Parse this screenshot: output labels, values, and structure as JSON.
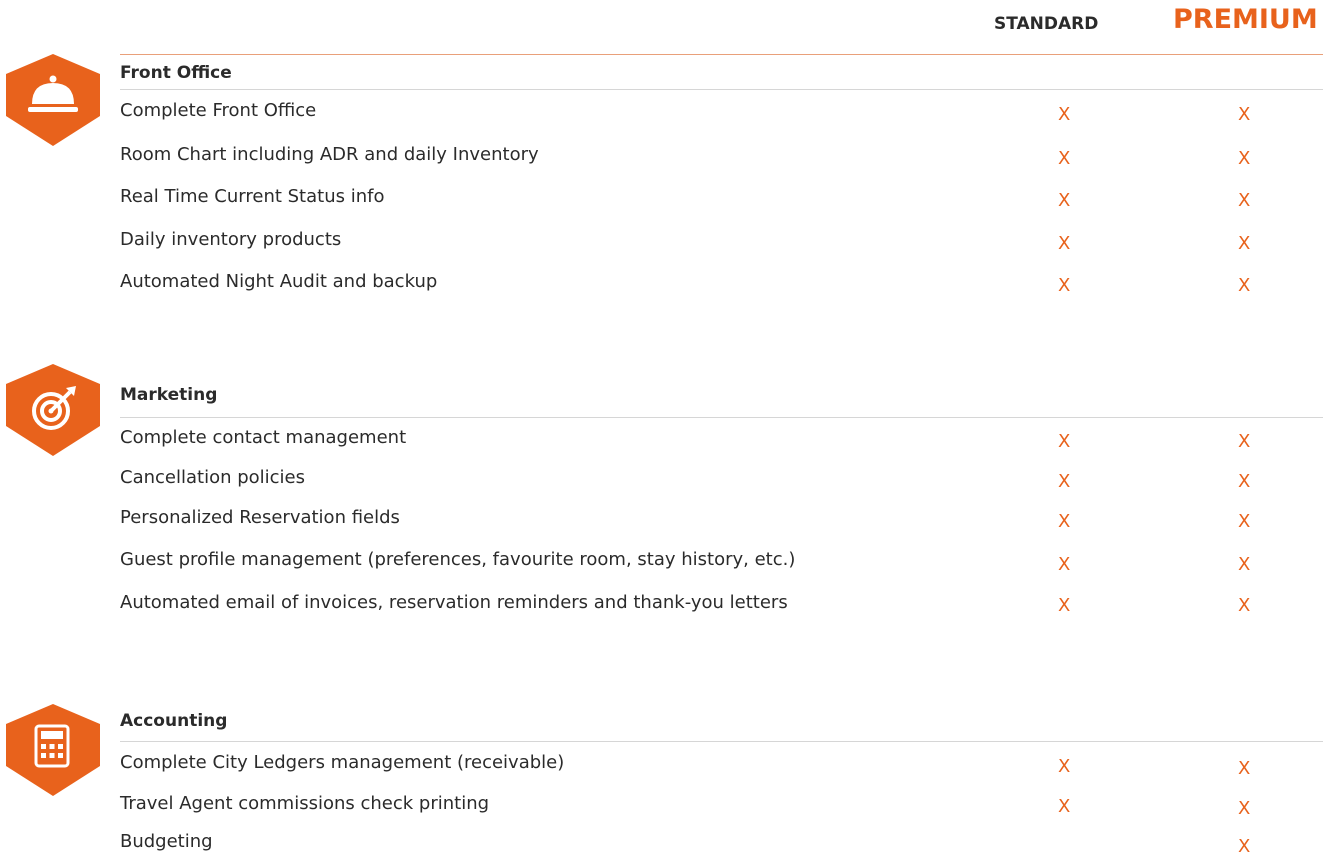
{
  "columns": {
    "standard": "STANDARD",
    "premium": "PREMIUM"
  },
  "colors": {
    "accent": "#e8621c",
    "text": "#2b2b2b",
    "rule": "#d6d6d6"
  },
  "sections": [
    {
      "title": "Front Office",
      "icon": "service-bell-icon",
      "rows": [
        {
          "label": "Complete Front Office",
          "standard": "X",
          "premium": "X"
        },
        {
          "label": "Room Chart including ADR and daily Inventory",
          "standard": "X",
          "premium": "X"
        },
        {
          "label": "Real Time Current Status info",
          "standard": "X",
          "premium": "X"
        },
        {
          "label": "Daily inventory products",
          "standard": "X",
          "premium": "X"
        },
        {
          "label": "Automated Night Audit and backup",
          "standard": "X",
          "premium": "X"
        }
      ]
    },
    {
      "title": "Marketing",
      "icon": "target-icon",
      "rows": [
        {
          "label": "Complete contact management",
          "standard": "X",
          "premium": "X"
        },
        {
          "label": "Cancellation policies",
          "standard": "X",
          "premium": "X"
        },
        {
          "label": "Personalized Reservation fields",
          "standard": "X",
          "premium": "X"
        },
        {
          "label": "Guest profile management (preferences, favourite room, stay history, etc.)",
          "standard": "X",
          "premium": "X"
        },
        {
          "label": "Automated email of  invoices, reservation reminders and thank-you letters",
          "standard": "X",
          "premium": "X"
        }
      ]
    },
    {
      "title": "Accounting",
      "icon": "calculator-icon",
      "rows": [
        {
          "label": "Complete City Ledgers management (receivable)",
          "standard": "X",
          "premium": "X"
        },
        {
          "label": "Travel Agent commissions check printing",
          "standard": "X",
          "premium": "X"
        },
        {
          "label": "Budgeting",
          "standard": "",
          "premium": "X"
        }
      ]
    }
  ]
}
